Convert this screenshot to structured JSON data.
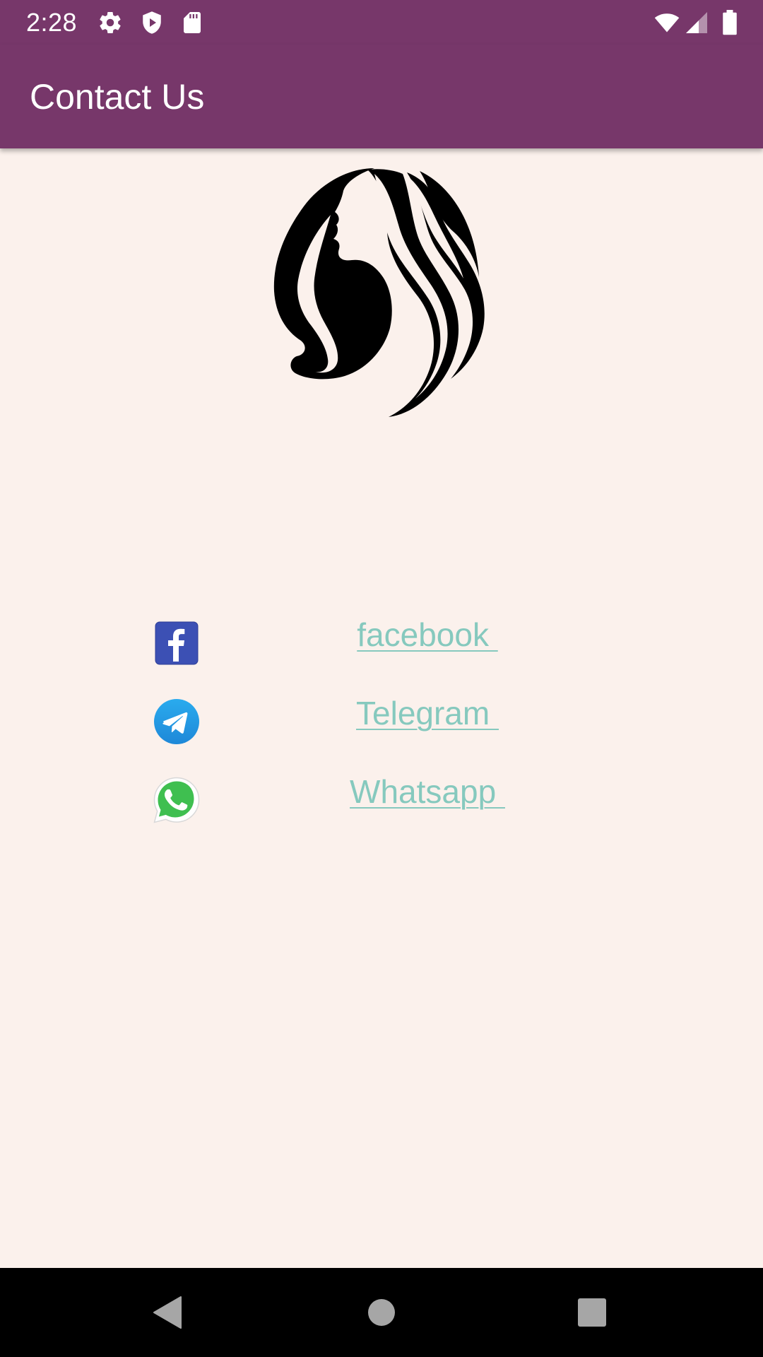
{
  "status_bar": {
    "time": "2:28",
    "left_icons": [
      "settings-icon",
      "shield-play-icon",
      "sd-card-icon"
    ],
    "right_icons": [
      "wifi-icon",
      "cell-signal-icon",
      "battery-icon"
    ],
    "background": "#77376A"
  },
  "app_bar": {
    "title": "Contact Us",
    "background": "#77376A"
  },
  "logo": {
    "icon": "woman-hair-silhouette-logo"
  },
  "contacts": [
    {
      "label": "facebook ",
      "icon": "facebook-icon"
    },
    {
      "label": "Telegram ",
      "icon": "telegram-icon"
    },
    {
      "label": "Whatsapp ",
      "icon": "whatsapp-icon"
    }
  ],
  "nav_bar": {
    "buttons": [
      "back-icon",
      "home-icon",
      "recents-icon"
    ]
  },
  "colors": {
    "page_background": "#FBF1EC",
    "link_color": "#86C9BE",
    "primary": "#77376A"
  }
}
